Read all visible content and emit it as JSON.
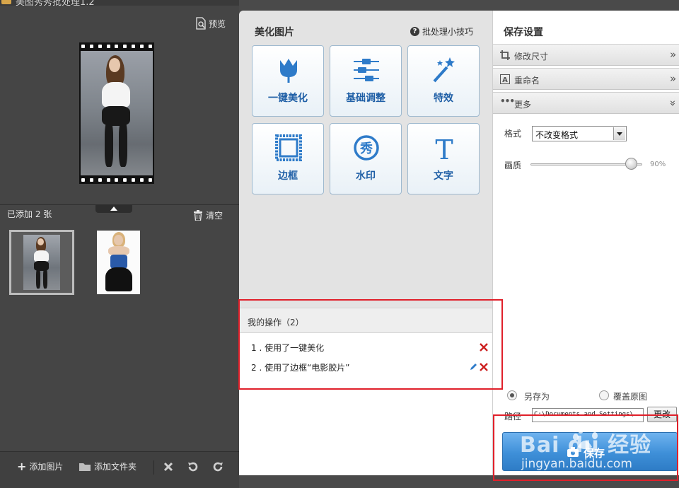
{
  "window": {
    "title": "美图秀秀批处理1.2"
  },
  "left": {
    "preview_label": "预览",
    "added_count": "已添加 2 张",
    "clear_label": "清空",
    "toolbar": {
      "add_image": "添加图片",
      "add_folder": "添加文件夹"
    }
  },
  "middle": {
    "title": "美化图片",
    "tips_label": "批处理小技巧",
    "tools": [
      {
        "label": "一键美化",
        "icon": "tulip-icon"
      },
      {
        "label": "基础调整",
        "icon": "sliders-icon"
      },
      {
        "label": "特效",
        "icon": "magic-wand-icon"
      },
      {
        "label": "边框",
        "icon": "frame-icon"
      },
      {
        "label": "水印",
        "icon": "watermark-icon"
      },
      {
        "label": "文字",
        "icon": "text-icon"
      }
    ],
    "operations": {
      "header": "我的操作（2）",
      "items": [
        {
          "index": "1",
          "text": "1 . 使用了一键美化"
        },
        {
          "index": "2",
          "text": "2 . 使用了边框“电影胶片”"
        }
      ]
    }
  },
  "right": {
    "title": "保存设置",
    "sections": {
      "resize": "修改尺寸",
      "rename": "重命名",
      "more": "更多"
    },
    "format_label": "格式",
    "format_value": "不改变格式",
    "quality_label": "画质",
    "quality_value": "90%",
    "quality_fraction": 0.9,
    "save_as_label": "另存为",
    "overwrite_label": "覆盖原图",
    "path_label": "路径",
    "path_value": "C:\\Documents and Settings\\",
    "change_label": "更改",
    "save_label": "保存"
  },
  "colors": {
    "accent_blue": "#1f5fa6",
    "save_button": "#3e8fd8",
    "annotation_red": "#e0202a",
    "delete_red": "#cc1f1f"
  },
  "watermark": {
    "brand": "Bai du 经验",
    "url": "jingyan.baidu.com"
  }
}
